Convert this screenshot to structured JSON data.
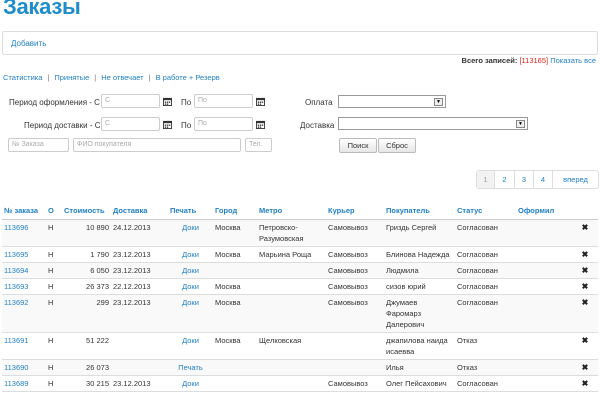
{
  "page": {
    "title": "Заказы"
  },
  "toolbar": {
    "add_label": "Добавить"
  },
  "records": {
    "label": "Всего записей:",
    "count": "[113165]",
    "show_all": "Показать все"
  },
  "nav_filters": [
    "Статистика",
    "Принятые",
    "Не отвечает",
    "В работе + Резерв"
  ],
  "filters": {
    "period_order_label": "Период оформления - С",
    "period_delivery_label": "Период доставки - С",
    "to_label": "По",
    "from_placeholder": "С",
    "to_placeholder": "По",
    "payment_label": "Оплата",
    "delivery_label": "Доставка",
    "order_no_placeholder": "№ Заказа",
    "buyer_placeholder": "ФИО покупателя",
    "phone_placeholder": "Тел.",
    "search_label": "Поиск",
    "reset_label": "Сброс"
  },
  "pagination": {
    "pages": [
      "1",
      "2",
      "3",
      "4"
    ],
    "current": "1",
    "next_label": "вперед"
  },
  "table": {
    "headers": {
      "number": "№ заказа",
      "o": "О",
      "cost": "Стоимость",
      "delivery": "Доставка",
      "print": "Печать",
      "city": "Город",
      "metro": "Метро",
      "courier": "Курьер",
      "buyer": "Покупатель",
      "status": "Статус",
      "issuer": "Оформил"
    },
    "rows": [
      {
        "number": "113696",
        "o": "Н",
        "cost": "10 890",
        "delivery": "24.12.2013",
        "print": "Доки",
        "city": "Москва",
        "metro": "Петровско-Разумовская",
        "courier": "Самовывоз",
        "buyer": "Гриздь Сергей",
        "status": "Согласован",
        "issuer": ""
      },
      {
        "number": "113695",
        "o": "Н",
        "cost": "1 790",
        "delivery": "23.12.2013",
        "print": "Доки",
        "city": "Москва",
        "metro": "Марьина Роща",
        "courier": "Самовывоз",
        "buyer": "Блинова Надежда",
        "status": "Согласован",
        "issuer": ""
      },
      {
        "number": "113694",
        "o": "Н",
        "cost": "6 050",
        "delivery": "23.12.2013",
        "print": "Доки",
        "city": "",
        "metro": "",
        "courier": "Самовывоз",
        "buyer": "Людмила",
        "status": "Согласован",
        "issuer": ""
      },
      {
        "number": "113693",
        "o": "Н",
        "cost": "26 373",
        "delivery": "22.12.2013",
        "print": "Доки",
        "city": "Москва",
        "metro": "",
        "courier": "Самовывоз",
        "buyer": "сизов юрий",
        "status": "Согласован",
        "issuer": ""
      },
      {
        "number": "113692",
        "o": "Н",
        "cost": "299",
        "delivery": "23.12.2013",
        "print": "Доки",
        "city": "Москва",
        "metro": "",
        "courier": "Самовывоз",
        "buyer": "Джумаев Фаромарз Далерович",
        "status": "Согласован",
        "issuer": ""
      },
      {
        "number": "113691",
        "o": "Н",
        "cost": "51 222",
        "delivery": "",
        "print": "Доки",
        "city": "Москва",
        "metro": "Щелковская",
        "courier": "",
        "buyer": "джапилова наида исаевва",
        "status": "Отказ",
        "issuer": ""
      },
      {
        "number": "113690",
        "o": "Н",
        "cost": "26 073",
        "delivery": "",
        "print": "Печать",
        "city": "",
        "metro": "",
        "courier": "",
        "buyer": "Илья",
        "status": "Отказ",
        "issuer": ""
      },
      {
        "number": "113689",
        "o": "Н",
        "cost": "30 215",
        "delivery": "23.12.2013",
        "print": "Доки",
        "city": "",
        "metro": "",
        "courier": "Самовывоз",
        "buyer": "Олег Пейсахович",
        "status": "Согласован",
        "issuer": ""
      }
    ]
  },
  "colors": {
    "accent": "#1f7fc5",
    "title": "#1f8ccb",
    "count": "#d9251c"
  }
}
